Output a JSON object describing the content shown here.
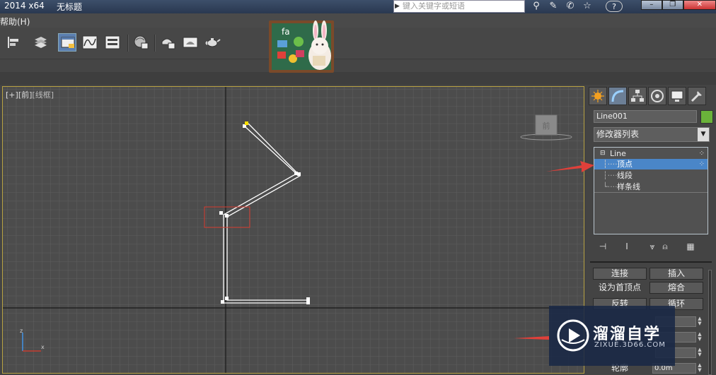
{
  "titlebar": {
    "version": "2014 x64",
    "document": "无标题",
    "search_placeholder": "键入关键字或短语",
    "help_label": "?"
  },
  "menubar": {
    "help": "帮助(H)"
  },
  "viewport": {
    "label_plus": "[+]",
    "label_view": "[前]",
    "label_mode": "[线框]",
    "viewcube_label": "前",
    "accent": "#b8a242"
  },
  "command_panel": {
    "object_name": "Line001",
    "object_color": "#6ab23a",
    "modifier_list": "修改器列表",
    "stack": {
      "root": "Line",
      "items": [
        "顶点",
        "线段",
        "样条线"
      ],
      "selected_index": 0
    },
    "geometry": {
      "connect": "连接",
      "insert": "插入",
      "make_first": "设为首顶点",
      "fuse": "熔合",
      "reverse": "反转",
      "cycle": "循环",
      "outline": "轮廓",
      "outline_value": "0.0m"
    }
  },
  "watermark": {
    "name": "溜溜自学",
    "url": "ZIXUE.3D66.COM"
  },
  "colors": {
    "selection": "#4a86c8",
    "arrow": "#e0403a",
    "selected_vertex": "#ffe000"
  }
}
